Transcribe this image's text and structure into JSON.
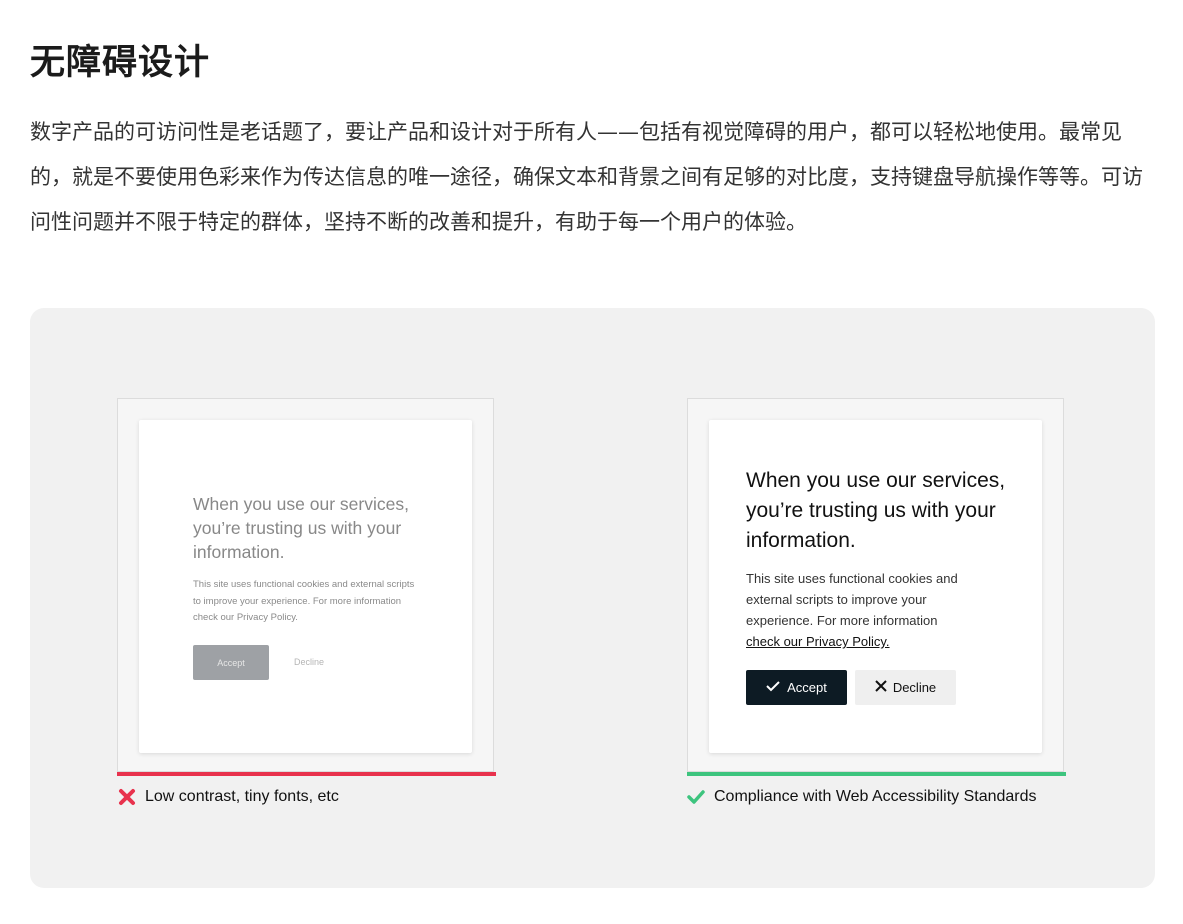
{
  "page": {
    "title": "无障碍设计",
    "paragraph": "数字产品的可访问性是老话题了，要让产品和设计对于所有人——包括有视觉障碍的用户，都可以轻松地使用。最常见的，就是不要使用色彩来作为传达信息的唯一途径，确保文本和背景之间有足够的对比度，支持键盘导航操作等等。可访问性问题并不限于特定的群体，坚持不断的改善和提升，有助于每一个用户的体验。"
  },
  "examples": {
    "bad": {
      "heading": "When you use our services, you’re trusting us with your information.",
      "body": "This site uses functional cookies and external scripts to improve your experience. For more information check our Privacy Policy.",
      "accept_label": "Accept",
      "decline_label": "Decline",
      "caption": "Low contrast, tiny fonts, etc",
      "caption_icon": "cross-icon",
      "status_color": "#e8324d"
    },
    "good": {
      "heading": "When you use our services, you’re trusting us with your information.",
      "body": "This site uses functional cookies and external scripts to improve your experience. For more information",
      "link": "check our Privacy Policy.",
      "accept_label": "Accept",
      "decline_label": "Decline",
      "caption": "Compliance with Web Accessibility Standards",
      "caption_icon": "check-icon",
      "status_color": "#3dc47e"
    }
  }
}
